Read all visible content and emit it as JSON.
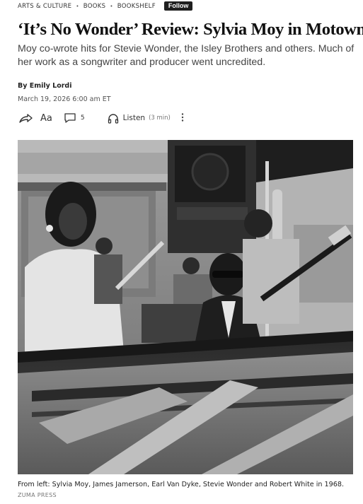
{
  "breadcrumb": {
    "items": [
      "ARTS & CULTURE",
      "BOOKS",
      "BOOKSHELF"
    ],
    "separator": "•",
    "follow_label": "Follow"
  },
  "article": {
    "headline": "‘It’s No Wonder’ Review: Sylvia Moy in Motown",
    "dek": "Moy co-wrote hits for Stevie Wonder, the Isley Brothers and others. Much of her work as a songwriter and producer went uncredited.",
    "byline_prefix": "By",
    "author": "Emily Lordi",
    "date": "March 19, 2026 6:00 am ET"
  },
  "toolbar": {
    "share_icon": "share-icon",
    "text_size_label": "Aa",
    "comment_icon": "comment-icon",
    "comment_count": "5",
    "listen_icon": "headphones-icon",
    "listen_label": "Listen",
    "listen_duration": "(3 min)",
    "more_icon": "more-vertical-icon"
  },
  "photo": {
    "caption": "From left: Sylvia Moy, James Jamerson, Earl Van Dyke, Stevie Wonder and Robert White in 1968.",
    "credit": "ZUMA PRESS"
  }
}
